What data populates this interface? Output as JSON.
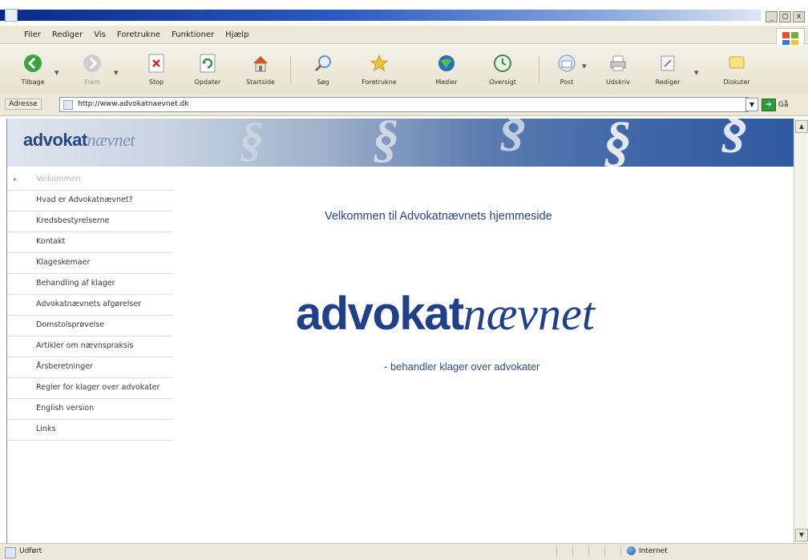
{
  "window": {
    "controls": [
      "_",
      "□",
      "x"
    ]
  },
  "menubar": {
    "items": [
      "Filer",
      "Rediger",
      "Vis",
      "Foretrukne",
      "Funktioner",
      "Hjælp"
    ]
  },
  "toolbar": {
    "buttons": [
      {
        "label": "Tilbage",
        "icon": "back-arrow-icon",
        "enabled": true
      },
      {
        "label": "Frem",
        "icon": "forward-arrow-icon",
        "enabled": false
      },
      {
        "label": "Stop",
        "icon": "stop-icon",
        "enabled": true
      },
      {
        "label": "Opdater",
        "icon": "refresh-icon",
        "enabled": true
      },
      {
        "label": "Startside",
        "icon": "home-icon",
        "enabled": true
      },
      {
        "label": "Søg",
        "icon": "search-icon",
        "enabled": true
      },
      {
        "label": "Foretrukne",
        "icon": "favorites-star-icon",
        "enabled": true
      },
      {
        "label": "Medier",
        "icon": "media-icon",
        "enabled": true
      },
      {
        "label": "Oversigt",
        "icon": "history-icon",
        "enabled": true
      },
      {
        "label": "Post",
        "icon": "mail-icon",
        "enabled": true
      },
      {
        "label": "Udskriv",
        "icon": "print-icon",
        "enabled": true
      },
      {
        "label": "Rediger",
        "icon": "edit-icon",
        "enabled": true
      },
      {
        "label": "Diskuter",
        "icon": "discuss-icon",
        "enabled": true
      }
    ]
  },
  "address": {
    "label": "Adresse",
    "url": "http://www.advokatnaevnet.dk",
    "go_label": "Gå"
  },
  "site": {
    "banner_logo_bold": "advokat",
    "banner_logo_italic": "nævnet",
    "nav": [
      "Velkommen",
      "Hvad er Advokatnævnet?",
      "Kredsbestyrelserne",
      "Kontakt",
      "Klageskemaer",
      "Behandling af klager",
      "Advokatnævnets afgørelser",
      "Domstolsprøvelse",
      "Artikler om nævnspraksis",
      "Årsberetninger",
      "Regler for klager over advokater",
      "English version",
      "Links"
    ],
    "active_nav": 0,
    "welcome": "Velkommen til Advokatnævnets hjemmeside",
    "logo_bold": "advokat",
    "logo_italic": "nævnet",
    "tagline": "- behandler klager over advokater",
    "colors": {
      "brand_blue": "#21408a",
      "banner_dark": "#2f5aa0"
    }
  },
  "status": {
    "text": "Udført",
    "zone": "Internet"
  }
}
